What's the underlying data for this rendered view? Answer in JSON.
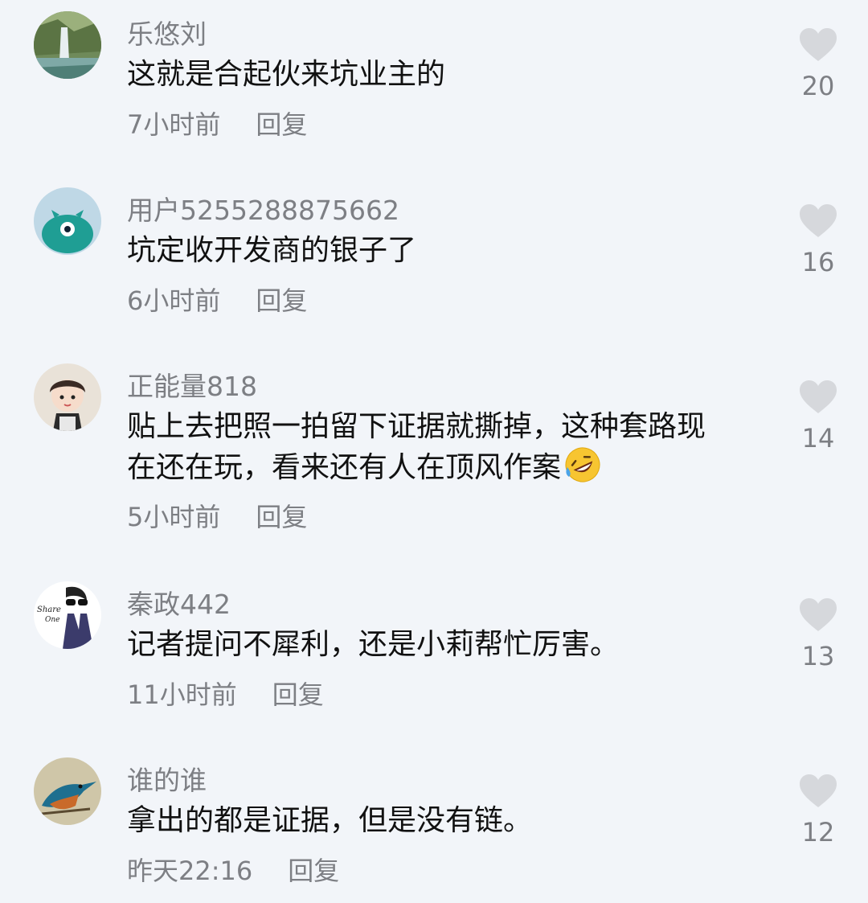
{
  "comments": [
    {
      "username": "乐悠刘",
      "text": "这就是合起伙来坑业主的",
      "time": "7小时前",
      "reply": "回复",
      "likes": "20",
      "avatar_icon": "waterfall-landscape-avatar"
    },
    {
      "username": "用户5255288875662",
      "text": "坑定收开发商的银子了",
      "time": "6小时前",
      "reply": "回复",
      "likes": "16",
      "avatar_icon": "teal-monster-avatar"
    },
    {
      "username": "正能量818",
      "text_line1": "贴上去把照一拍留下证据就撕掉，这种套路现",
      "text_line2": "在还在玩，看来还有人在顶风作案",
      "emoji": "rolling-laughing-emoji",
      "time": "5小时前",
      "reply": "回复",
      "likes": "14",
      "avatar_icon": "cartoon-boy-avatar"
    },
    {
      "username": "秦政442",
      "text": "记者提问不犀利，还是小莉帮忙厉害。",
      "time": "11小时前",
      "reply": "回复",
      "likes": "13",
      "avatar_icon": "share-one-sketch-avatar"
    },
    {
      "username": "谁的谁",
      "text": "拿出的都是证据，但是没有链。",
      "time": "昨天22:16",
      "reply": "回复",
      "likes": "12",
      "avatar_icon": "kingfisher-bird-avatar"
    }
  ],
  "colors": {
    "background": "#f2f5f9",
    "secondary_text": "#7d7f84",
    "primary_text": "#111111",
    "heart": "#d6d8dc"
  }
}
